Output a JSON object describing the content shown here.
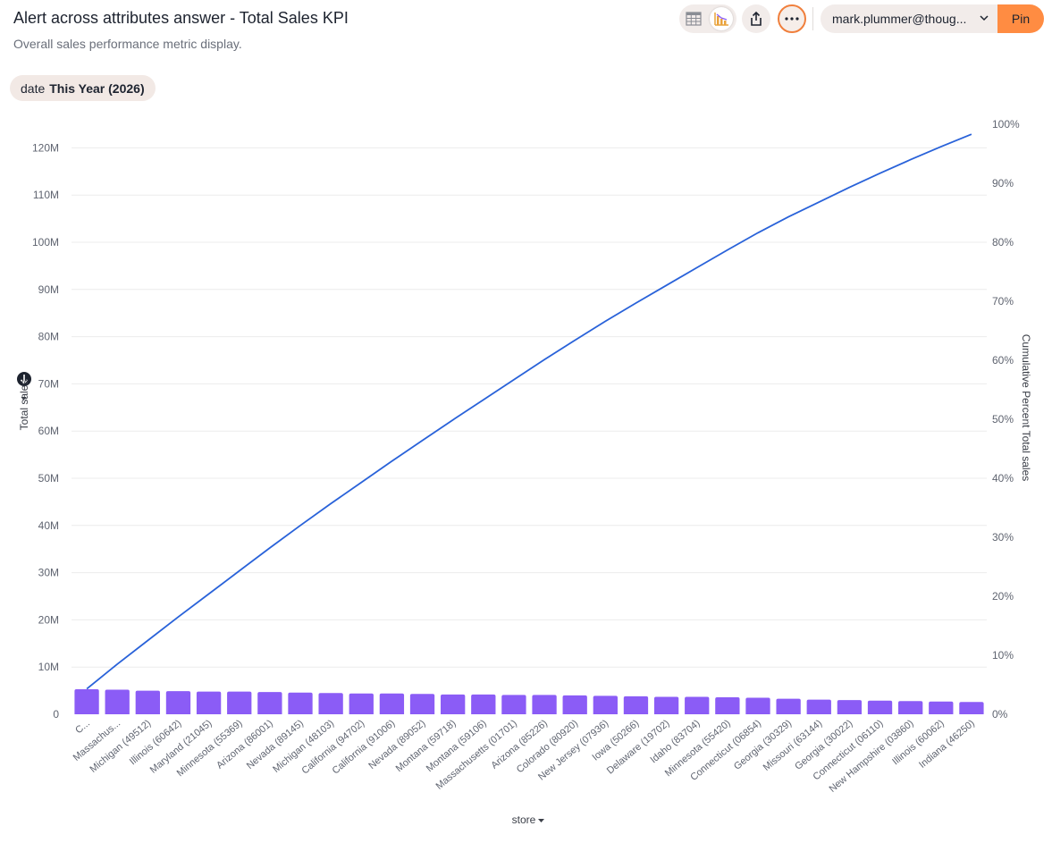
{
  "header": {
    "title": "Alert across attributes answer - Total Sales KPI",
    "subtitle": "Overall sales performance metric display."
  },
  "filter": {
    "key": "date",
    "value": "This Year (2026)"
  },
  "toolbar": {
    "user": "mark.plummer@thoug...",
    "pin_label": "Pin",
    "more_label": "⋯"
  },
  "colors": {
    "bar": "#8b5cf6",
    "line": "#2962d9",
    "accent": "#ff8c42"
  },
  "chart_data": {
    "type": "bar",
    "categories": [
      "C...",
      "Massachus...",
      "Michigan (49512)",
      "Illinois (60642)",
      "Maryland (21045)",
      "Minnesota (55369)",
      "Arizona (86001)",
      "Nevada (89145)",
      "Michigan (48103)",
      "California (94702)",
      "California (91006)",
      "Nevada (89052)",
      "Montana (59718)",
      "Montana (59106)",
      "Massachusetts (01701)",
      "Arizona (85226)",
      "Colorado (80920)",
      "New Jersey (07936)",
      "Iowa (50266)",
      "Delaware (19702)",
      "Idaho (83704)",
      "Minnesota (55420)",
      "Connecticut (06854)",
      "Georgia (30329)",
      "Missouri (63144)",
      "Georgia (30022)",
      "Connecticut (06110)",
      "New Hampshire (03860)",
      "Illinois (60062)",
      "Indiana (46250)"
    ],
    "series": [
      {
        "name": "Total sales",
        "values": [
          5.3,
          5.2,
          5.0,
          4.9,
          4.8,
          4.8,
          4.7,
          4.6,
          4.5,
          4.4,
          4.4,
          4.3,
          4.2,
          4.2,
          4.1,
          4.1,
          4.0,
          3.9,
          3.8,
          3.7,
          3.7,
          3.6,
          3.5,
          3.3,
          3.1,
          3.0,
          2.9,
          2.8,
          2.7,
          2.6
        ]
      },
      {
        "name": "Cumulative Percent Total sales",
        "values": [
          4.3,
          8.5,
          12.5,
          16.5,
          20.4,
          24.3,
          28.2,
          32.0,
          35.7,
          39.3,
          42.9,
          46.4,
          49.9,
          53.3,
          56.7,
          60.1,
          63.4,
          66.6,
          69.7,
          72.7,
          75.7,
          78.7,
          81.6,
          84.3,
          86.8,
          89.3,
          91.7,
          94.0,
          96.2,
          98.3
        ]
      }
    ],
    "xlabel": "store",
    "ylabel": "Total sales",
    "y2label": "Cumulative Percent Total sales",
    "yticks": [
      "0",
      "10M",
      "20M",
      "30M",
      "40M",
      "50M",
      "60M",
      "70M",
      "80M",
      "90M",
      "100M",
      "110M",
      "120M"
    ],
    "y2ticks": [
      "0%",
      "10%",
      "20%",
      "30%",
      "40%",
      "50%",
      "60%",
      "70%",
      "80%",
      "90%",
      "100%"
    ],
    "ylim": [
      0,
      125
    ],
    "y2lim": [
      0,
      100
    ],
    "grid": true
  }
}
